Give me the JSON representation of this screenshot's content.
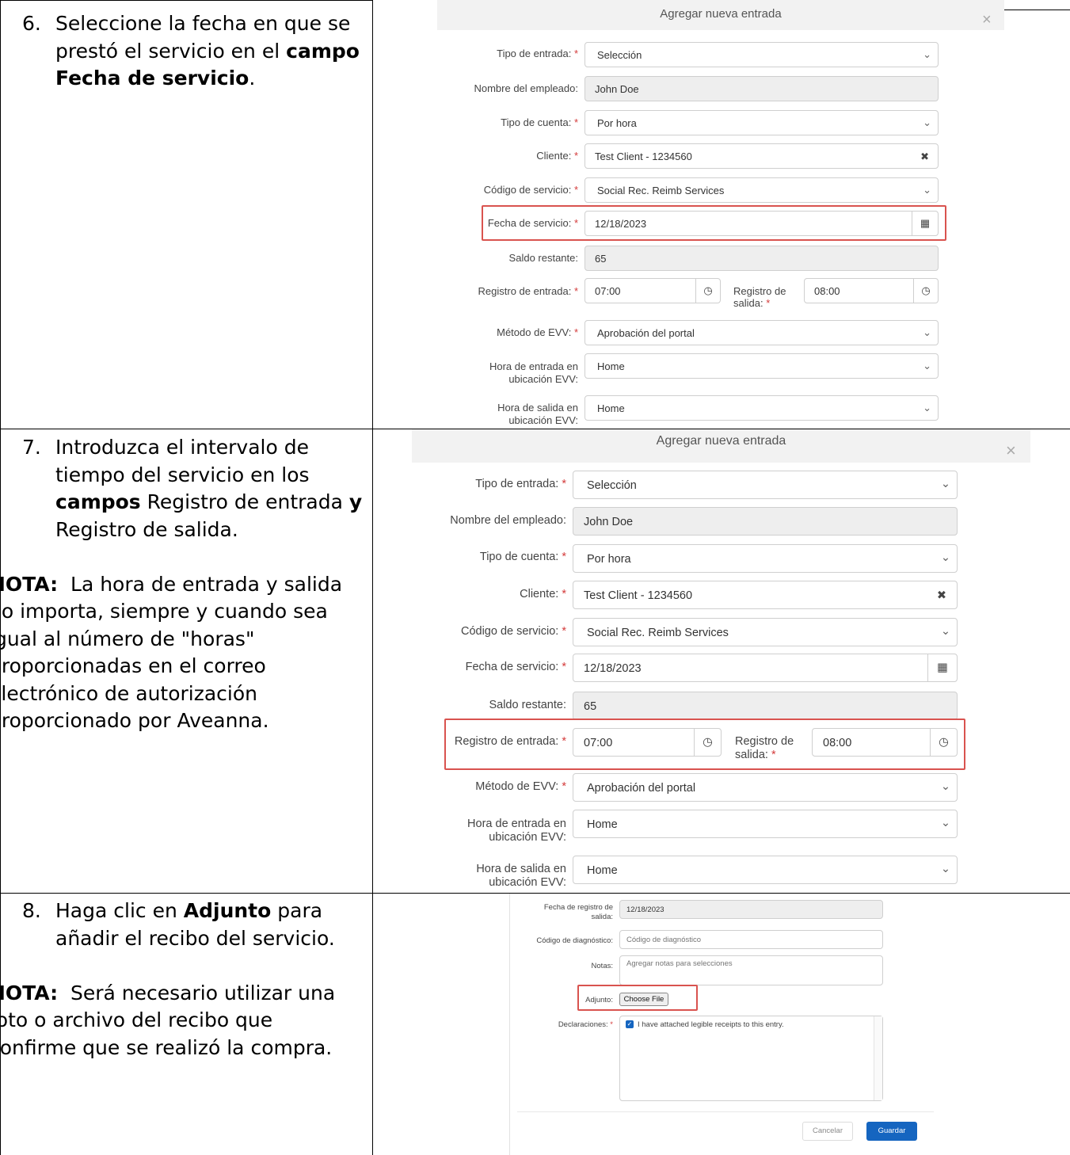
{
  "steps": [
    {
      "number": "6.",
      "text_parts": [
        "Seleccione la fecha en que se prestó el servicio en el ",
        "campo Fecha de servicio",
        "."
      ]
    },
    {
      "number": "7.",
      "text_parts": [
        "Introduzca el intervalo de tiempo del servicio en los ",
        "campos",
        " Registro de entrada ",
        "y",
        " Registro de salida."
      ],
      "note_label": "NOTA:",
      "note_text": "La hora de entrada y salida no importa, siempre y cuando sea igual al número de \"horas\" proporcionadas en el correo electrónico de autorización proporcionado por Aveanna."
    },
    {
      "number": "8.",
      "text_parts": [
        "Haga clic en ",
        "Adjunto",
        " para añadir el recibo del servicio."
      ],
      "note_label": "NOTA:",
      "note_text": "Será necesario utilizar una foto o archivo del recibo que confirme que se realizó la compra."
    }
  ],
  "dialog": {
    "title": "Agregar nueva entrada",
    "close": "×",
    "labels": {
      "tipo_entrada": "Tipo de entrada:",
      "nombre_empleado": "Nombre del empleado:",
      "tipo_cuenta": "Tipo de cuenta:",
      "cliente": "Cliente:",
      "codigo_servicio": "Código de servicio:",
      "fecha_servicio": "Fecha de servicio:",
      "saldo": "Saldo restante:",
      "registro_entrada": "Registro de entrada:",
      "registro_salida_1": "Registro de",
      "registro_salida_2": "salida:",
      "metodo_evv": "Método de EVV:",
      "hora_entrada_1": "Hora de entrada en",
      "hora_entrada_2": "ubicación EVV:",
      "hora_salida_1": "Hora de salida en",
      "hora_salida_2": "ubicación EVV:"
    },
    "values": {
      "tipo_entrada": "Selección",
      "nombre_empleado": "John Doe",
      "tipo_cuenta": "Por hora",
      "cliente": "Test Client - 1234560",
      "codigo_servicio": "Social Rec. Reimb Services",
      "fecha_servicio": "12/18/2023",
      "saldo": "65",
      "registro_entrada": "07:00",
      "registro_salida": "08:00",
      "metodo_evv": "Aprobación del portal",
      "hora_entrada_ubic": "Home",
      "hora_salida_ubic": "Home"
    },
    "required_mark": "*",
    "clear_mark": "✖"
  },
  "dialog3": {
    "labels": {
      "fecha_registro_salida_1": "Fecha de registro de",
      "fecha_registro_salida_2": "salida:",
      "codigo_diagnostico": "Código de diagnóstico:",
      "notas": "Notas:",
      "adjunto": "Adjunto:",
      "declaraciones": "Declaraciones:"
    },
    "values": {
      "fecha_registro_salida": "12/18/2023"
    },
    "placeholders": {
      "codigo_diagnostico": "Código de diagnóstico",
      "notas": "Agregar notas para selecciones"
    },
    "choose_file": "Choose File",
    "declaration_text": "I have attached legible receipts to this entry.",
    "cancel": "Cancelar",
    "save": "Guardar"
  },
  "colors": {
    "highlight": "#d9534f",
    "required": "#d43b3b",
    "primary_button": "#1565c0"
  }
}
